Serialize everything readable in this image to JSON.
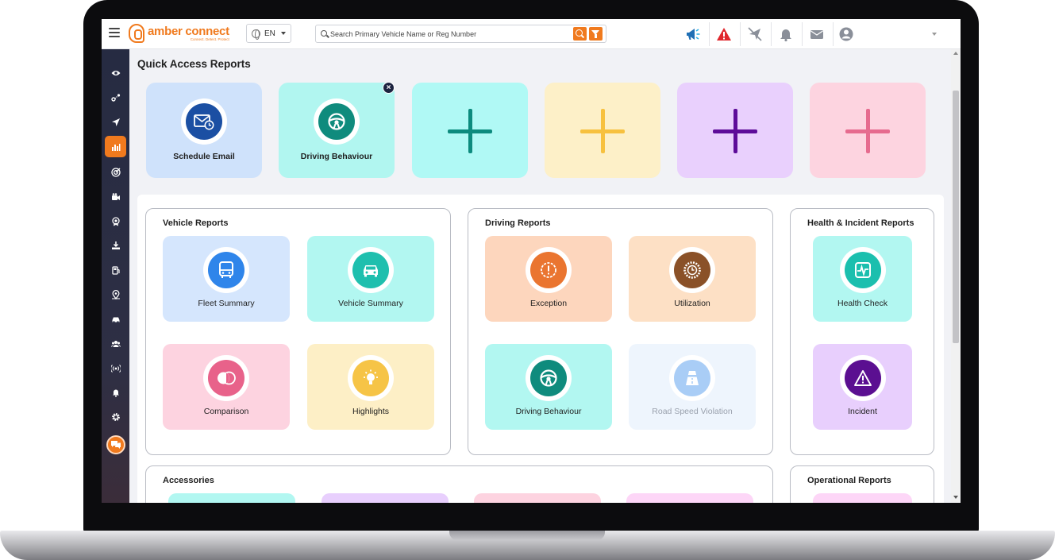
{
  "header": {
    "brand": "amber connect",
    "tagline": "Connect. Detect. Protect",
    "language": "EN",
    "search_placeholder": "Search Primary Vehicle Name or Reg Number"
  },
  "colors": {
    "accent": "#f07a1e",
    "sidebar": "#262b42",
    "alert_red": "#e0262c",
    "announce_blue": "#1f6fb5"
  },
  "sidebar": {
    "items": [
      {
        "icon": "eye-icon"
      },
      {
        "icon": "route-icon"
      },
      {
        "icon": "navigation-icon"
      },
      {
        "icon": "reports-icon",
        "active": true
      },
      {
        "icon": "target-icon"
      },
      {
        "icon": "video-camera-icon"
      },
      {
        "icon": "badge-icon"
      },
      {
        "icon": "download-icon"
      },
      {
        "icon": "fuel-icon"
      },
      {
        "icon": "location-pin-icon"
      },
      {
        "icon": "car-icon"
      },
      {
        "icon": "users-icon"
      },
      {
        "icon": "broadcast-icon"
      },
      {
        "icon": "bell-icon"
      },
      {
        "icon": "gear-icon"
      }
    ],
    "chat_icon": "chat-icon"
  },
  "quick_access": {
    "title": "Quick Access Reports",
    "cards": [
      {
        "label": "Schedule Email",
        "icon": "schedule-email-icon",
        "bg": "#cfe2fb",
        "icon_bg": "#1b4fa3"
      },
      {
        "label": "Driving Behaviour",
        "icon": "steering-wheel-icon",
        "bg": "#b1f6f0",
        "icon_bg": "#0f8b7d",
        "removable": true
      },
      {
        "empty": true,
        "bg": "#b0f9f5",
        "plus_color": "#0c8b7e"
      },
      {
        "empty": true,
        "bg": "#fdf0c8",
        "plus_color": "#f7c13f"
      },
      {
        "empty": true,
        "bg": "#e9d0fd",
        "plus_color": "#5d0c99"
      },
      {
        "empty": true,
        "bg": "#fdd4e0",
        "plus_color": "#e66b8f"
      }
    ]
  },
  "groups": {
    "vehicle": {
      "title": "Vehicle Reports",
      "cards": [
        {
          "label": "Fleet Summary",
          "icon": "bus-icon",
          "bg": "#d5e6fd",
          "icon_bg": "#2f85ea"
        },
        {
          "label": "Vehicle Summary",
          "icon": "car-front-icon",
          "bg": "#b2f7f1",
          "icon_bg": "#1fbfae"
        },
        {
          "label": "Comparison",
          "icon": "compare-icon",
          "bg": "#fdd3e0",
          "icon_bg": "#e8628a"
        },
        {
          "label": "Highlights",
          "icon": "lightbulb-icon",
          "bg": "#fdefc6",
          "icon_bg": "#f6c446"
        }
      ]
    },
    "driving": {
      "title": "Driving Reports",
      "cards": [
        {
          "label": "Exception",
          "icon": "exception-icon",
          "bg": "#fdd6bd",
          "icon_bg": "#ea7530"
        },
        {
          "label": "Utilization",
          "icon": "utilization-icon",
          "bg": "#fde0c5",
          "icon_bg": "#8a5128"
        },
        {
          "label": "Driving Behaviour",
          "icon": "steering-wheel-icon",
          "bg": "#b2f7f1",
          "icon_bg": "#0f8b7d"
        },
        {
          "label": "Road Speed Violation",
          "icon": "road-icon",
          "bg": "#eef5fd",
          "icon_bg": "#a9cdf6",
          "disabled": true
        }
      ]
    },
    "health": {
      "title": "Health & Incident Reports",
      "cards": [
        {
          "label": "Health Check",
          "icon": "health-monitor-icon",
          "bg": "#b2f7f1",
          "icon_bg": "#1bbfae"
        },
        {
          "label": "Incident",
          "icon": "warning-triangle-icon",
          "bg": "#e8cffd",
          "icon_bg": "#5b0f91"
        }
      ]
    },
    "accessories": {
      "title": "Accessories",
      "card_bgs": [
        "#b2f7f1",
        "#e8cffd",
        "#fdd3e0",
        "#fdd6f7"
      ]
    },
    "operational": {
      "title": "Operational Reports",
      "card_bgs": [
        "#fdd6f7"
      ]
    }
  }
}
